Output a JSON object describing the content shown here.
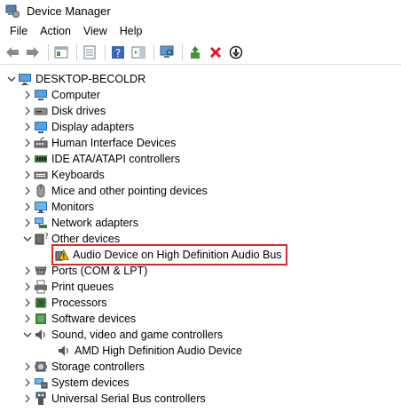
{
  "window": {
    "title": "Device Manager",
    "icon": "device-manager-icon"
  },
  "menu": [
    "File",
    "Action",
    "View",
    "Help"
  ],
  "toolbar": [
    "back-arrow-icon",
    "forward-arrow-icon",
    "show-hide-console-tree-icon",
    "properties-icon",
    "help-icon",
    "action-pane-icon",
    "scan-hardware-icon",
    "update-driver-icon",
    "uninstall-icon",
    "disable-device-icon"
  ],
  "tree": {
    "root": "DESKTOP-BECOLDR",
    "categories": [
      {
        "label": "Computer",
        "icon": "computer-icon",
        "expanded": false
      },
      {
        "label": "Disk drives",
        "icon": "disk-drive-icon",
        "expanded": false
      },
      {
        "label": "Display adapters",
        "icon": "display-adapter-icon",
        "expanded": false
      },
      {
        "label": "Human Interface Devices",
        "icon": "hid-icon",
        "expanded": false
      },
      {
        "label": "IDE ATA/ATAPI controllers",
        "icon": "ide-controller-icon",
        "expanded": false
      },
      {
        "label": "Keyboards",
        "icon": "keyboard-icon",
        "expanded": false
      },
      {
        "label": "Mice and other pointing devices",
        "icon": "mouse-icon",
        "expanded": false
      },
      {
        "label": "Monitors",
        "icon": "monitor-icon",
        "expanded": false
      },
      {
        "label": "Network adapters",
        "icon": "network-adapter-icon",
        "expanded": false
      },
      {
        "label": "Other devices",
        "icon": "other-devices-icon",
        "expanded": true,
        "children": [
          {
            "label": "Audio Device on High Definition Audio Bus",
            "icon": "warning-device-icon",
            "highlighted": true
          }
        ]
      },
      {
        "label": "Ports (COM & LPT)",
        "icon": "port-icon",
        "expanded": false
      },
      {
        "label": "Print queues",
        "icon": "printer-icon",
        "expanded": false
      },
      {
        "label": "Processors",
        "icon": "processor-icon",
        "expanded": false
      },
      {
        "label": "Software devices",
        "icon": "software-device-icon",
        "expanded": false
      },
      {
        "label": "Sound, video and game controllers",
        "icon": "speaker-icon",
        "expanded": true,
        "children": [
          {
            "label": "AMD High Definition Audio Device",
            "icon": "speaker-icon",
            "highlighted": false
          }
        ]
      },
      {
        "label": "Storage controllers",
        "icon": "storage-controller-icon",
        "expanded": false
      },
      {
        "label": "System devices",
        "icon": "system-device-icon",
        "expanded": false
      },
      {
        "label": "Universal Serial Bus controllers",
        "icon": "usb-icon",
        "expanded": false
      }
    ]
  },
  "colors": {
    "highlight_border": "#e0262c",
    "warning": "#f2c200",
    "error_x": "#e81123",
    "icon_blue": "#2b6cb0"
  }
}
